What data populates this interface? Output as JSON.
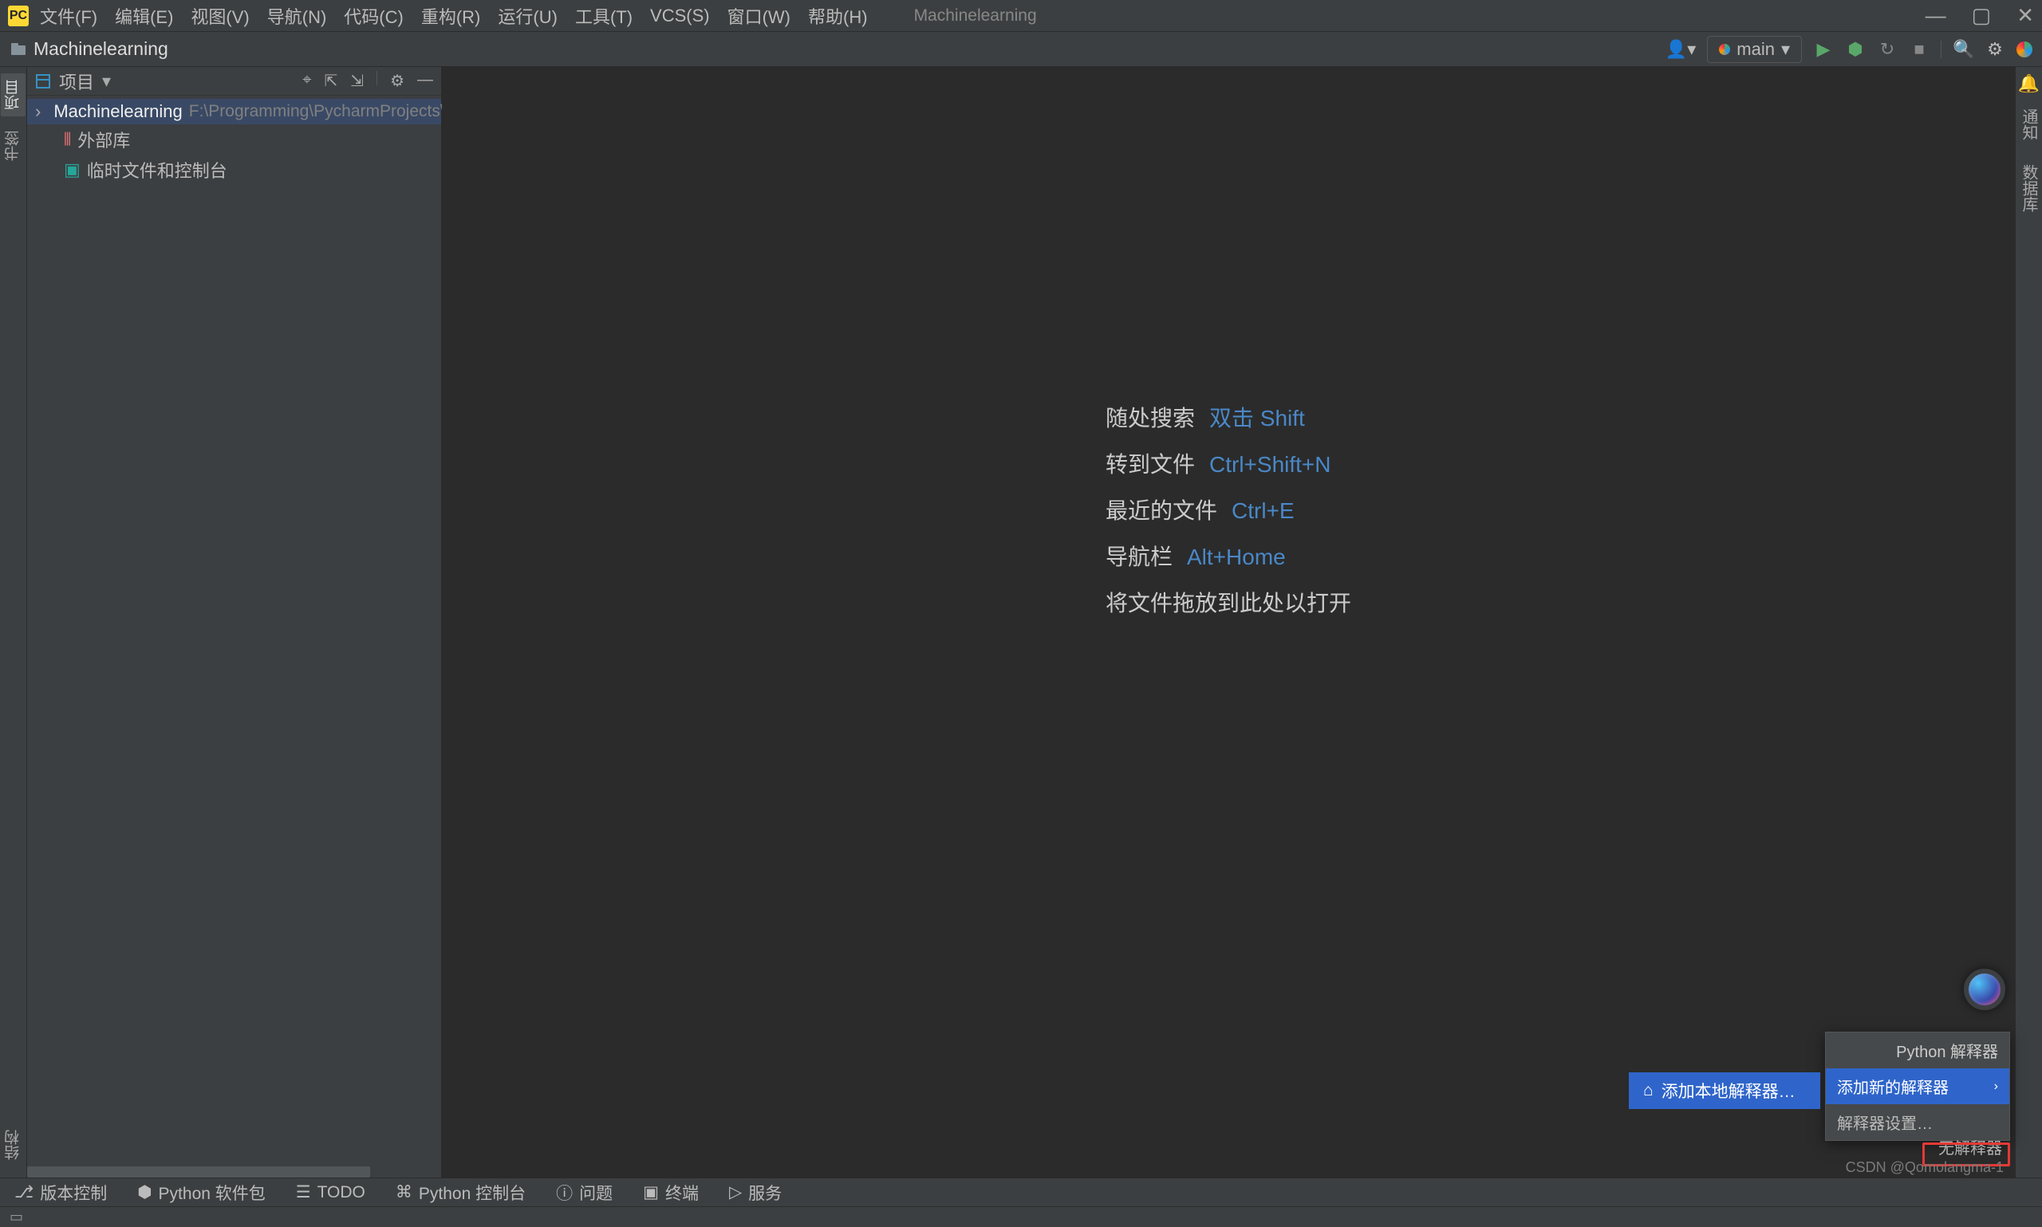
{
  "menubar": {
    "items": [
      "文件(F)",
      "编辑(E)",
      "视图(V)",
      "导航(N)",
      "代码(C)",
      "重构(R)",
      "运行(U)",
      "工具(T)",
      "VCS(S)",
      "窗口(W)",
      "帮助(H)"
    ],
    "project_title": "Machinelearning"
  },
  "breadcrumb": {
    "project_name": "Machinelearning"
  },
  "toolbar_right": {
    "run_config": "main",
    "run_config_dropdown": "▾"
  },
  "project_panel": {
    "title": "项目",
    "root_name": "Machinelearning",
    "root_path": "F:\\Programming\\PycharmProjects\\",
    "external_libs": "外部库",
    "scratches": "临时文件和控制台"
  },
  "left_gutter": {
    "project_tab": "项目",
    "bookmarks_tab": "书签",
    "structure_tab": "结构"
  },
  "right_gutter": {
    "notifications_tab": "通知",
    "database_tab": "数据库"
  },
  "hints": {
    "rows": [
      {
        "label": "随处搜索",
        "key": "双击 Shift"
      },
      {
        "label": "转到文件",
        "key": "Ctrl+Shift+N"
      },
      {
        "label": "最近的文件",
        "key": "Ctrl+E"
      },
      {
        "label": "导航栏",
        "key": "Alt+Home"
      }
    ],
    "drop_hint": "将文件拖放到此处以打开"
  },
  "bottom_tools": {
    "items": [
      "版本控制",
      "Python 软件包",
      "TODO",
      "Python 控制台",
      "问题",
      "终端",
      "服务"
    ]
  },
  "popup": {
    "header": "Python 解释器",
    "add_new": "添加新的解释器",
    "settings": "解释器设置…",
    "add_local": "添加本地解释器…"
  },
  "status": {
    "no_interpreter": "无解释器",
    "watermark": "CSDN @Qomolangma-1"
  }
}
